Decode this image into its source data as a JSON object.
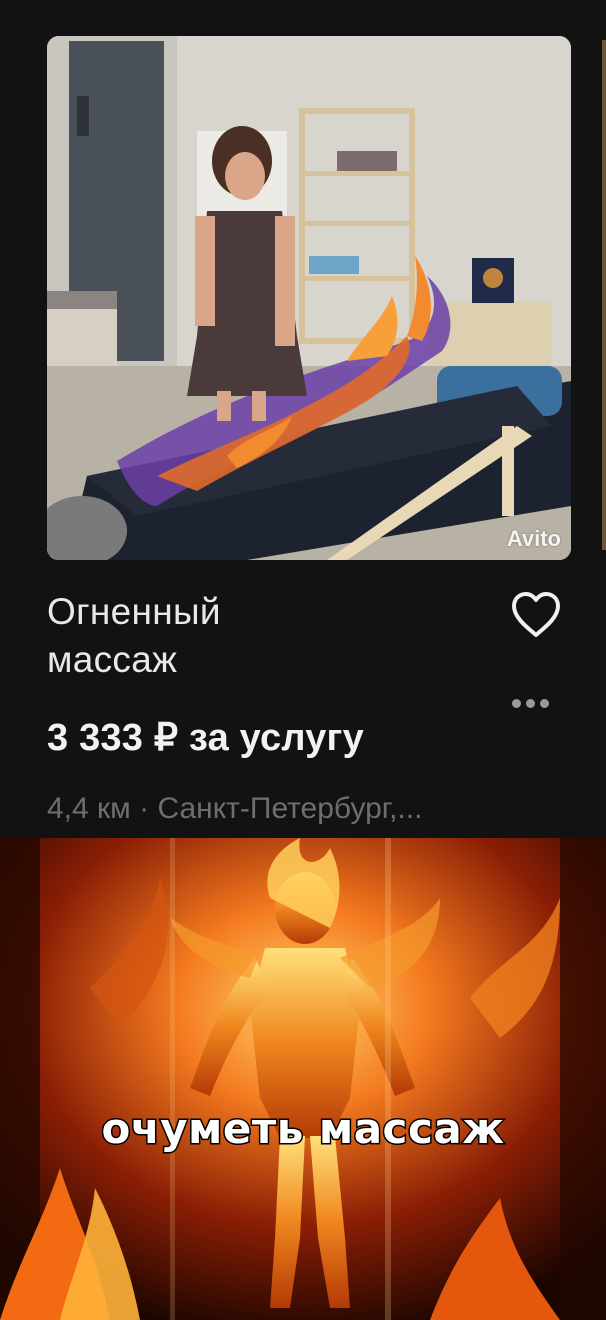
{
  "listing": {
    "photo_watermark": "Avito",
    "title_line1": "Огненный",
    "title_line2": "массаж",
    "price": "3 333 ₽ за услугу",
    "location": "4,4 км · Санкт-Петербург,..."
  },
  "icons": {
    "favorite": "heart-outline-icon",
    "more": "more-dots-icon"
  },
  "meme": {
    "caption": "очуметь массаж"
  },
  "colors": {
    "background": "#121212",
    "title": "#e8e8e8",
    "price": "#f2f2f2",
    "location": "#6e6e6e",
    "icon": "#f0f0f0"
  }
}
